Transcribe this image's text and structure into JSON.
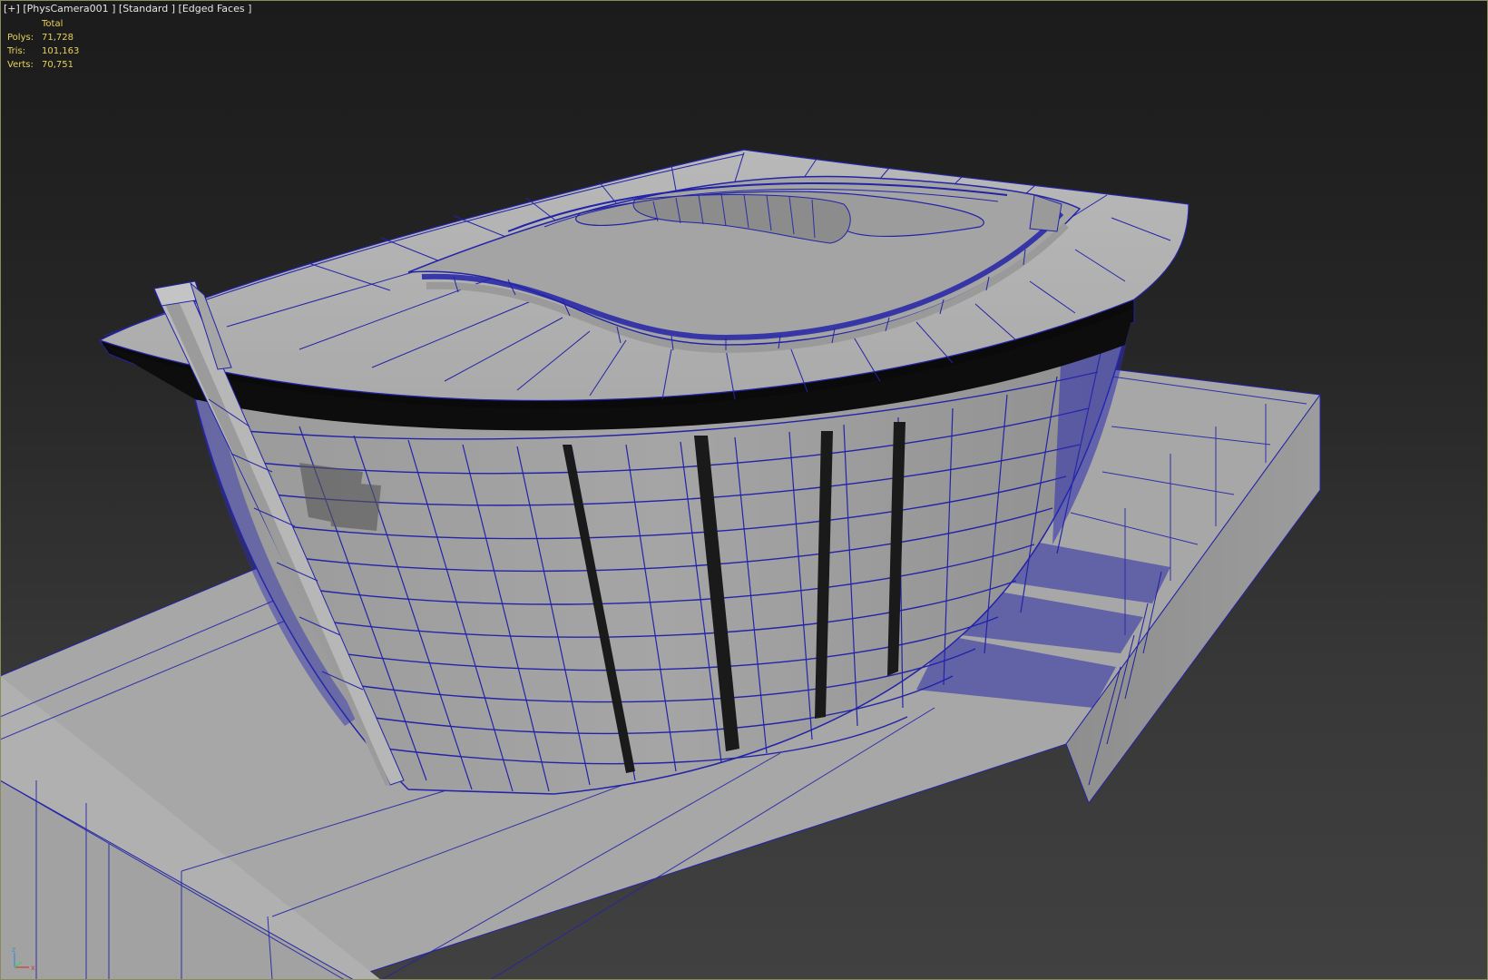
{
  "viewport": {
    "label": {
      "plus": "[+]",
      "camera": "[PhysCamera001 ]",
      "shading": "[Standard ]",
      "mode": "[Edged Faces ]"
    },
    "stats": {
      "header": "Total",
      "rows": [
        {
          "key": "Polys:",
          "value": "71,728"
        },
        {
          "key": "Tris:",
          "value": "101,163"
        },
        {
          "key": "Verts:",
          "value": "70,751"
        }
      ]
    },
    "axis": {
      "z": "z",
      "x": "x"
    },
    "colors": {
      "wire": "#2323a8",
      "surface": "#a9a9a9",
      "stat_text": "#e8d25a",
      "label_text": "#e6e6e6"
    }
  }
}
